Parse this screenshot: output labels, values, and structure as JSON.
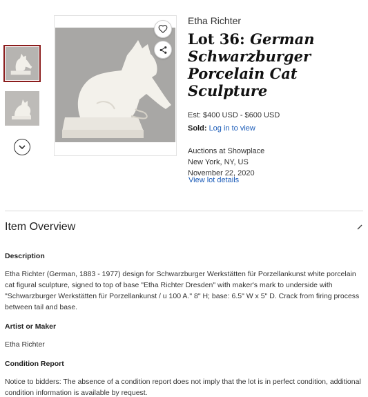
{
  "colors": {
    "accent_link": "#1a5bb8",
    "selected_thumb_border": "#8b1c1c"
  },
  "gallery": {
    "thumbnails": [
      "cat sculpture view 1",
      "cat sculpture view 2"
    ],
    "nav_icon": "chevron-down-icon",
    "favorite_icon": "heart-icon",
    "share_icon": "share-icon"
  },
  "lot": {
    "artist": "Etha Richter",
    "title_prefix": "Lot 36: ",
    "title_italic": "German Schwarzburger Porcelain Cat Sculpture",
    "estimate": "Est: $400 USD - $600 USD",
    "sold_label": "Sold:",
    "sold_link": "Log in to view",
    "auction_house": "Auctions at Showplace",
    "location": "New York, NY, US",
    "date": "November 22, 2020",
    "details_link": "View lot details"
  },
  "overview": {
    "title": "Item Overview",
    "description_label": "Description",
    "description_text": "Etha Richter (German, 1883 - 1977) design for Schwarzburger Werkstätten für Porzellankunst white porcelain cat figural sculpture, signed to top of base \"Etha Richter Dresden\" with maker's mark to underside with \"Schwarzburger Werkstätten für Porzellankunst / u 100 A.\" 8\" H; base: 6.5\" W x 5\" D. Crack from firing process between tail and base.",
    "artist_label": "Artist or Maker",
    "artist_value": "Etha Richter",
    "condition_label": "Condition Report",
    "condition_text": "Notice to bidders: The absence of a condition report does not imply that the lot is in perfect condition, additional condition information is available by request."
  }
}
